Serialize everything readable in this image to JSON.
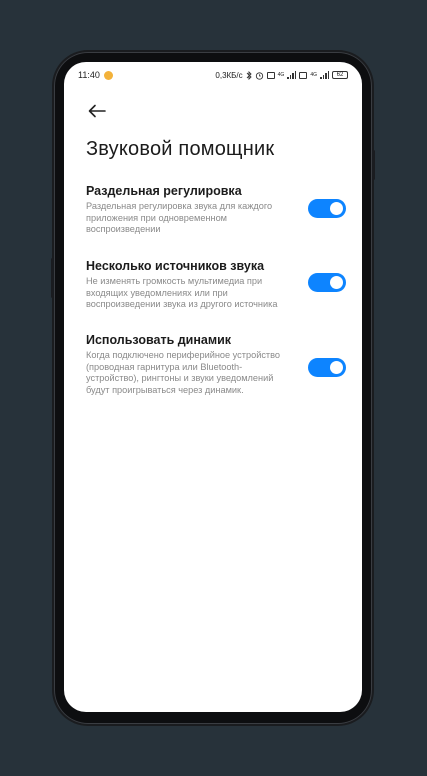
{
  "status_bar": {
    "time": "11:40",
    "network_speed": "0,3КБ/с",
    "battery": "62",
    "sim1": "4G",
    "sim2": "4G"
  },
  "header": {
    "title": "Звуковой помощник"
  },
  "settings": [
    {
      "title": "Раздельная регулировка",
      "description": "Раздельная регулировка звука для каждого приложения при одновременном воспроизведении",
      "enabled": true
    },
    {
      "title": "Несколько источников звука",
      "description": "Не изменять громкость мультимедиа при входящих уведомлениях или при воспроизведении звука из другого источника",
      "enabled": true
    },
    {
      "title": "Использовать динамик",
      "description": "Когда подключено периферийное устройство (проводная гарнитура или Bluetooth-устройство), рингтоны и звуки уведомлений будут проигрываться через динамик.",
      "enabled": true
    }
  ],
  "colors": {
    "background": "#27323a",
    "toggle_on": "#0d84ff",
    "screen": "#ffffff"
  },
  "icons": {
    "back": "arrow-left-icon",
    "notification": "notification-dot-icon",
    "bluetooth": "bluetooth-icon",
    "alarm": "alarm-icon",
    "signal": "signal-icon",
    "battery": "battery-icon"
  }
}
